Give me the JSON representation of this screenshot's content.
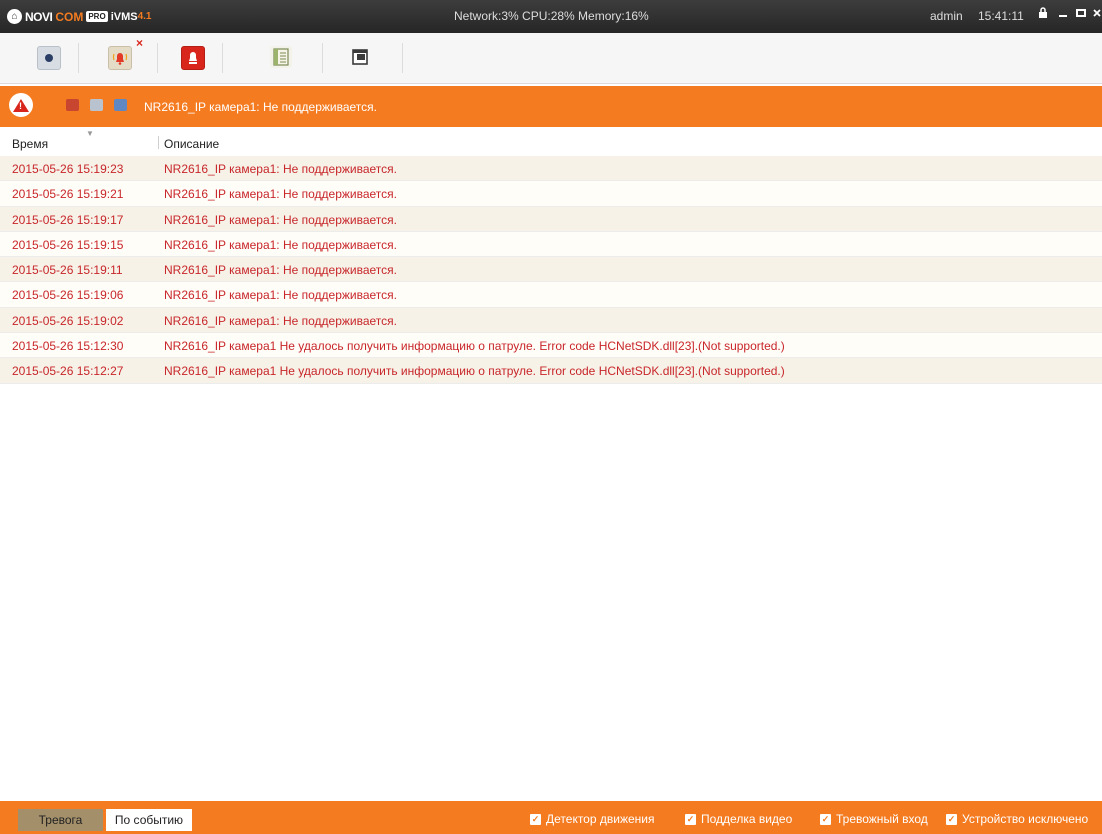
{
  "app": {
    "brand": "NOVI",
    "brand_accent": "COM",
    "pro_badge": "PRO",
    "product": "iVMS",
    "version": "4.1"
  },
  "titlebar": {
    "system_info": "Network:3% CPU:28% Memory:16%",
    "user": "admin",
    "clock": "15:41:11"
  },
  "toolbar": {
    "buttons": [
      {
        "icon": "record-icon"
      },
      {
        "icon": "alarm-bell-icon"
      },
      {
        "icon": "alarm-device-icon"
      },
      {
        "icon": "event-list-icon"
      },
      {
        "icon": "panel-icon"
      }
    ],
    "close_glyph": "×"
  },
  "alarm_banner": {
    "message": "NR2616_IP камера1: Не поддерживается."
  },
  "table": {
    "headers": {
      "time": "Время",
      "description": "Описание"
    },
    "rows": [
      {
        "time": "2015-05-26 15:19:23",
        "description": "NR2616_IP камера1: Не поддерживается."
      },
      {
        "time": "2015-05-26 15:19:21",
        "description": "NR2616_IP камера1: Не поддерживается."
      },
      {
        "time": "2015-05-26 15:19:17",
        "description": "NR2616_IP камера1: Не поддерживается."
      },
      {
        "time": "2015-05-26 15:19:15",
        "description": "NR2616_IP камера1: Не поддерживается."
      },
      {
        "time": "2015-05-26 15:19:11",
        "description": "NR2616_IP камера1: Не поддерживается."
      },
      {
        "time": "2015-05-26 15:19:06",
        "description": "NR2616_IP камера1: Не поддерживается."
      },
      {
        "time": "2015-05-26 15:19:02",
        "description": "NR2616_IP камера1: Не поддерживается."
      },
      {
        "time": "2015-05-26 15:12:30",
        "description": "NR2616_IP камера1 Не удалось получить информацию о патруле. Error code HCNetSDK.dll[23].(Not supported.)"
      },
      {
        "time": "2015-05-26 15:12:27",
        "description": "NR2616_IP камера1 Не удалось получить информацию о патруле. Error code HCNetSDK.dll[23].(Not supported.)"
      }
    ]
  },
  "statusbar": {
    "tabs": {
      "alarm": "Тревога",
      "event": "По событию"
    },
    "filters": [
      {
        "label": "Детектор движения",
        "checked": true
      },
      {
        "label": "Подделка видео",
        "checked": true
      },
      {
        "label": "Тревожный вход",
        "checked": true
      },
      {
        "label": "Устройство исключено",
        "checked": true
      }
    ]
  },
  "colors": {
    "accent": "#f47b20",
    "titlebar": "#2d2d2d",
    "error_text": "#c8262a"
  }
}
